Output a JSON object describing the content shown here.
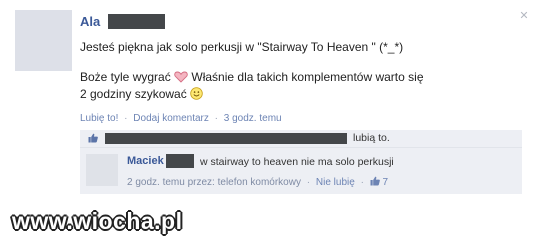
{
  "post": {
    "author": "Ala",
    "line1": "Jesteś piękna jak solo perkusji w \"Stairway To Heaven \" (*_*)",
    "line2_part1": "Boże tyle wygrać ",
    "line2_part2": " Właśnie dla takich komplementów warto się 2 godziny szykować ",
    "like_link": "Lubię to!",
    "comment_link": "Dodaj komentarz",
    "time": "3 godz. temu",
    "meta_separator": "·"
  },
  "likes": {
    "text": "lubią to."
  },
  "comment": {
    "author": "Maciek",
    "text": "w stairway to heaven nie ma solo perkusji",
    "time_via": "2 godz. temu przez: telefon komórkowy",
    "unlike_link": "Nie lubię",
    "like_count": "7",
    "meta_separator": "·"
  },
  "watermark": {
    "text": "www.wiocha.pl"
  },
  "icons": {
    "close": "close-icon",
    "heart": "heart-icon",
    "smile": "smile-icon",
    "thumbs_up": "thumbs-up-icon"
  },
  "colors": {
    "link_blue": "#3b5998",
    "meta_blue": "#6d84b4",
    "panel_bg": "#edeff4",
    "redaction": "#44474a"
  }
}
